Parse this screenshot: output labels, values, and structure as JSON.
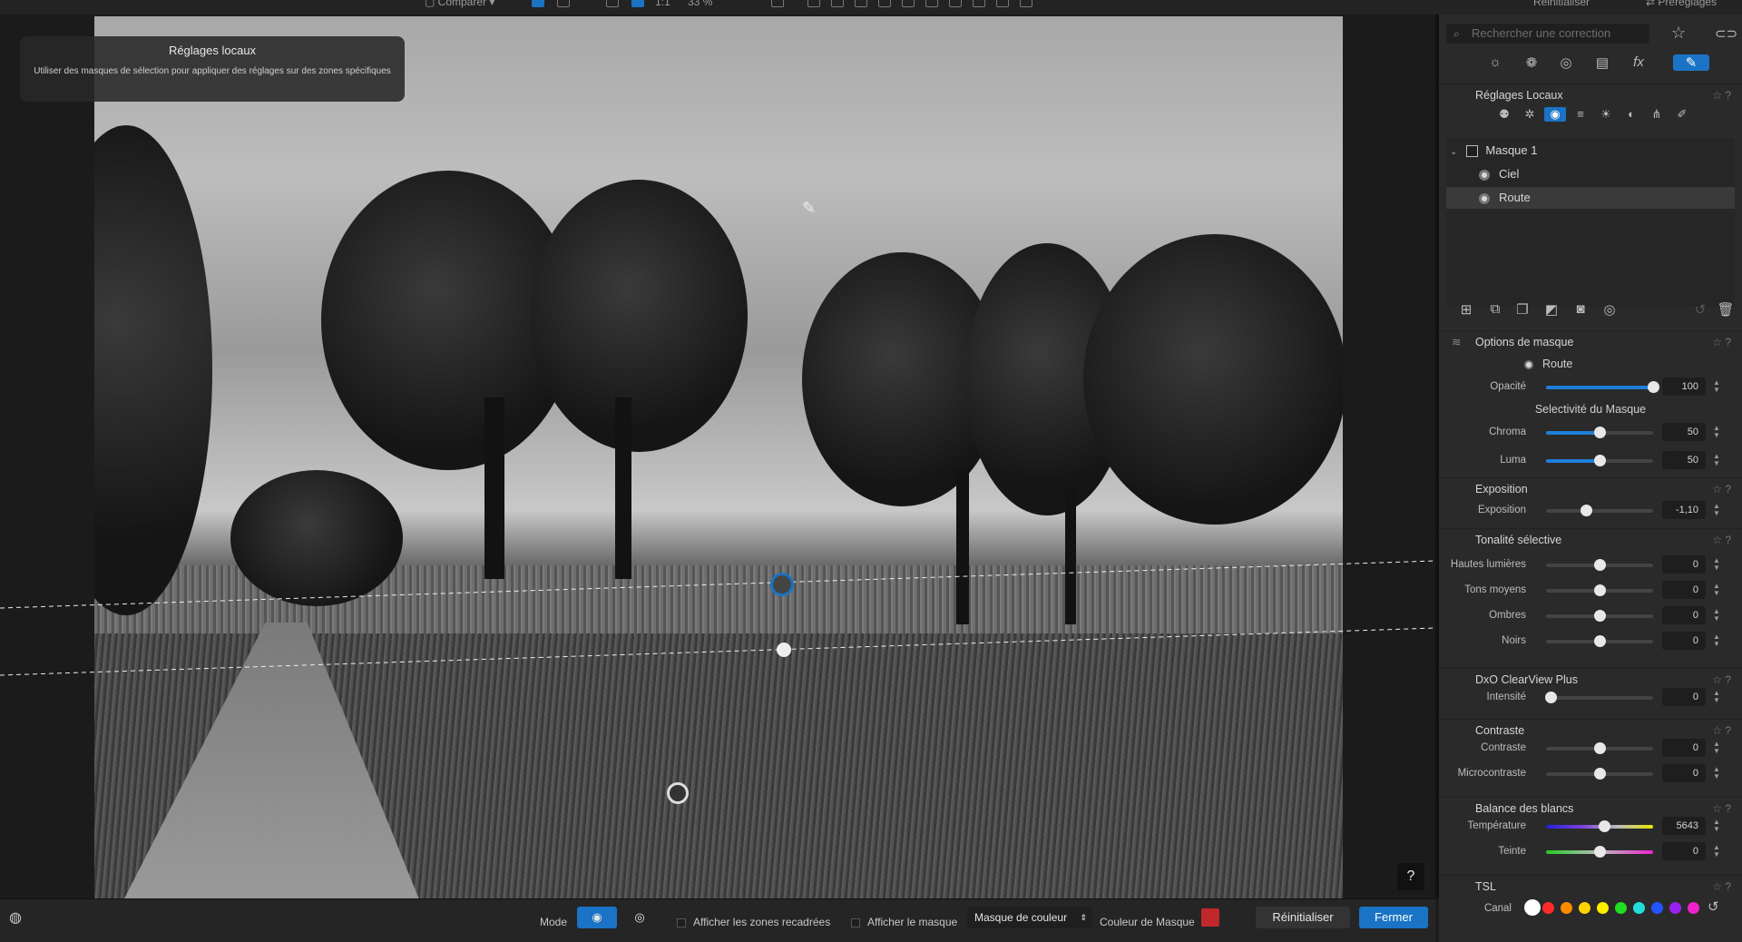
{
  "topbar": {
    "compare_label": "Comparer",
    "zoom_label": "33 %",
    "ratio_label": "1:1",
    "reset_label": "Réinitialiser",
    "presets_label": "Préréglages"
  },
  "tooltip": {
    "title": "Réglages locaux",
    "text": "Utiliser des masques de sélection pour appliquer des réglages sur des zones spécifiques"
  },
  "help_label": "?",
  "search": {
    "placeholder": "Rechercher une correction"
  },
  "panel": {
    "local_title": "Réglages Locaux",
    "masks": [
      {
        "label": "Masque 1"
      },
      {
        "label": "Ciel"
      },
      {
        "label": "Route"
      }
    ],
    "mask_options": {
      "title": "Options de masque",
      "selected": "Route",
      "opacity_label": "Opacité",
      "opacity_value": "100",
      "opacity_pct": 100,
      "selectivity_title": "Selectivité du Masque",
      "chroma_label": "Chroma",
      "chroma_value": "50",
      "chroma_pct": 50,
      "luma_label": "Luma",
      "luma_value": "50",
      "luma_pct": 50
    },
    "exposure": {
      "title": "Exposition",
      "label": "Exposition",
      "value": "-1,10",
      "pct": 37
    },
    "tonal": {
      "title": "Tonalité sélective",
      "rows": [
        {
          "label": "Hautes lumières",
          "value": "0"
        },
        {
          "label": "Tons moyens",
          "value": "0"
        },
        {
          "label": "Ombres",
          "value": "0"
        },
        {
          "label": "Noirs",
          "value": "0"
        }
      ]
    },
    "clearview": {
      "title": "DxO ClearView Plus",
      "label": "Intensité",
      "value": "0"
    },
    "contrast": {
      "title": "Contraste",
      "rows": [
        {
          "label": "Contraste",
          "value": "0"
        },
        {
          "label": "Microcontraste",
          "value": "0"
        }
      ]
    },
    "wb": {
      "title": "Balance des blancs",
      "temp_label": "Température",
      "temp_value": "5643",
      "temp_pct": 54,
      "tint_label": "Teinte",
      "tint_value": "0"
    },
    "hsl": {
      "title": "TSL",
      "channel_label": "Canal",
      "colors": [
        "#ffffff",
        "#ff2a2a",
        "#ff8c00",
        "#ffd400",
        "#ffee00",
        "#22dd22",
        "#22dddd",
        "#2255ff",
        "#9922ee",
        "#ee22cc"
      ]
    }
  },
  "bottom": {
    "mode_label": "Mode",
    "crop_label": "Afficher les zones recadrées",
    "show_mask_label": "Afficher le masque",
    "mask_type": "Masque de couleur",
    "mask_color_label": "Couleur de Masque",
    "mask_color": "#c0282c",
    "reset_label": "Réinitialiser",
    "close_label": "Fermer"
  },
  "colors": {
    "accent": "#1a73c4"
  }
}
